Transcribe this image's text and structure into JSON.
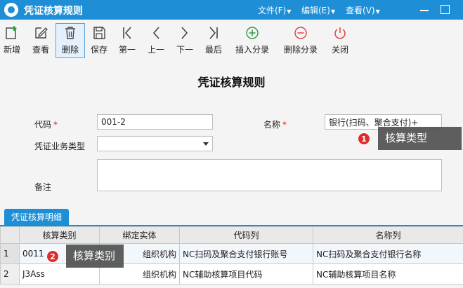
{
  "window": {
    "title": "凭证核算规则",
    "menus": [
      "文件(F)",
      "编辑(E)",
      "查看(V)"
    ]
  },
  "toolbar": {
    "new": "新增",
    "view": "查看",
    "delete": "删除",
    "save": "保存",
    "first": "第一",
    "prev": "上一",
    "next": "下一",
    "last": "最后",
    "insert_entry": "插入分录",
    "delete_entry": "删除分录",
    "close": "关闭"
  },
  "form": {
    "heading": "凭证核算规则",
    "code_label": "代码",
    "code_value": "001-2",
    "name_label": "名称",
    "name_value": "银行(扫码、聚合支付)+",
    "biz_type_label": "凭证业务类型",
    "biz_type_value": "",
    "remark_label": "备注",
    "required_mark": "*"
  },
  "callouts": [
    {
      "number": "1",
      "text": "核算类型"
    },
    {
      "number": "2",
      "text": "核算类别"
    }
  ],
  "detail": {
    "tab_label": "凭证核算明细",
    "columns": [
      "核算类别",
      "绑定实体",
      "代码列",
      "名称列"
    ],
    "rows": [
      {
        "index": "1",
        "category": "0011",
        "entity": "组织机构",
        "code_col": "NC扫码及聚合支付银行账号",
        "name_col": "NC扫码及聚合支付银行名称"
      },
      {
        "index": "2",
        "category": "J3Ass",
        "entity": "组织机构",
        "code_col": "NC辅助核算项目代码",
        "name_col": "NC辅助核算项目名称"
      }
    ]
  },
  "colors": {
    "accent": "#1e8fd6",
    "required": "#e02020",
    "badge": "#e02b2b"
  }
}
